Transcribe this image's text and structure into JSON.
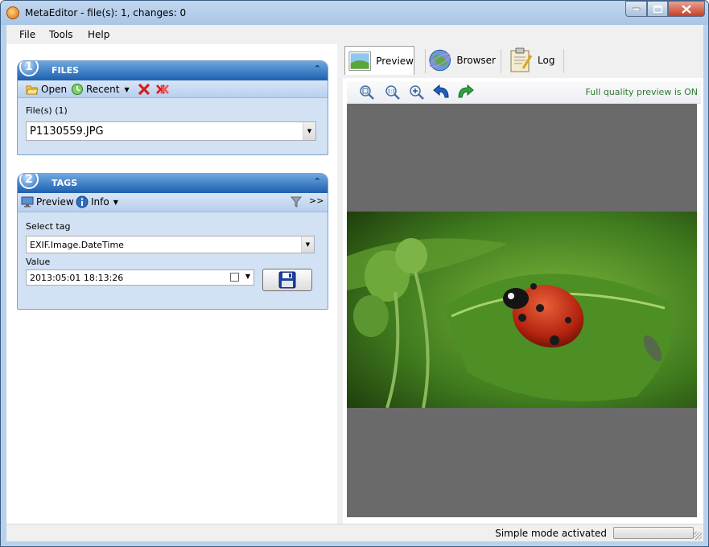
{
  "window": {
    "title": "MetaEditor - file(s): 1, changes: 0"
  },
  "menu": {
    "file": "File",
    "tools": "Tools",
    "help": "Help"
  },
  "files_panel": {
    "number": "1",
    "title": "FILES",
    "open_label": "Open",
    "recent_label": "Recent",
    "files_label": "File(s) (1)",
    "selected_file": "P1130559.JPG"
  },
  "tags_panel": {
    "number": "2",
    "title": "TAGS",
    "preview_label": "Preview",
    "info_label": "Info",
    "more_label": ">>",
    "select_tag_label": "Select tag",
    "selected_tag": "EXIF.Image.DateTime",
    "value_label": "Value",
    "value": "2013:05:01 18:13:26"
  },
  "tabs": [
    {
      "label": "Preview"
    },
    {
      "label": "Browser"
    },
    {
      "label": "Log"
    }
  ],
  "preview": {
    "quality_text": "Full quality preview is ON"
  },
  "status": {
    "text": "Simple mode activated",
    "progress": 0
  }
}
